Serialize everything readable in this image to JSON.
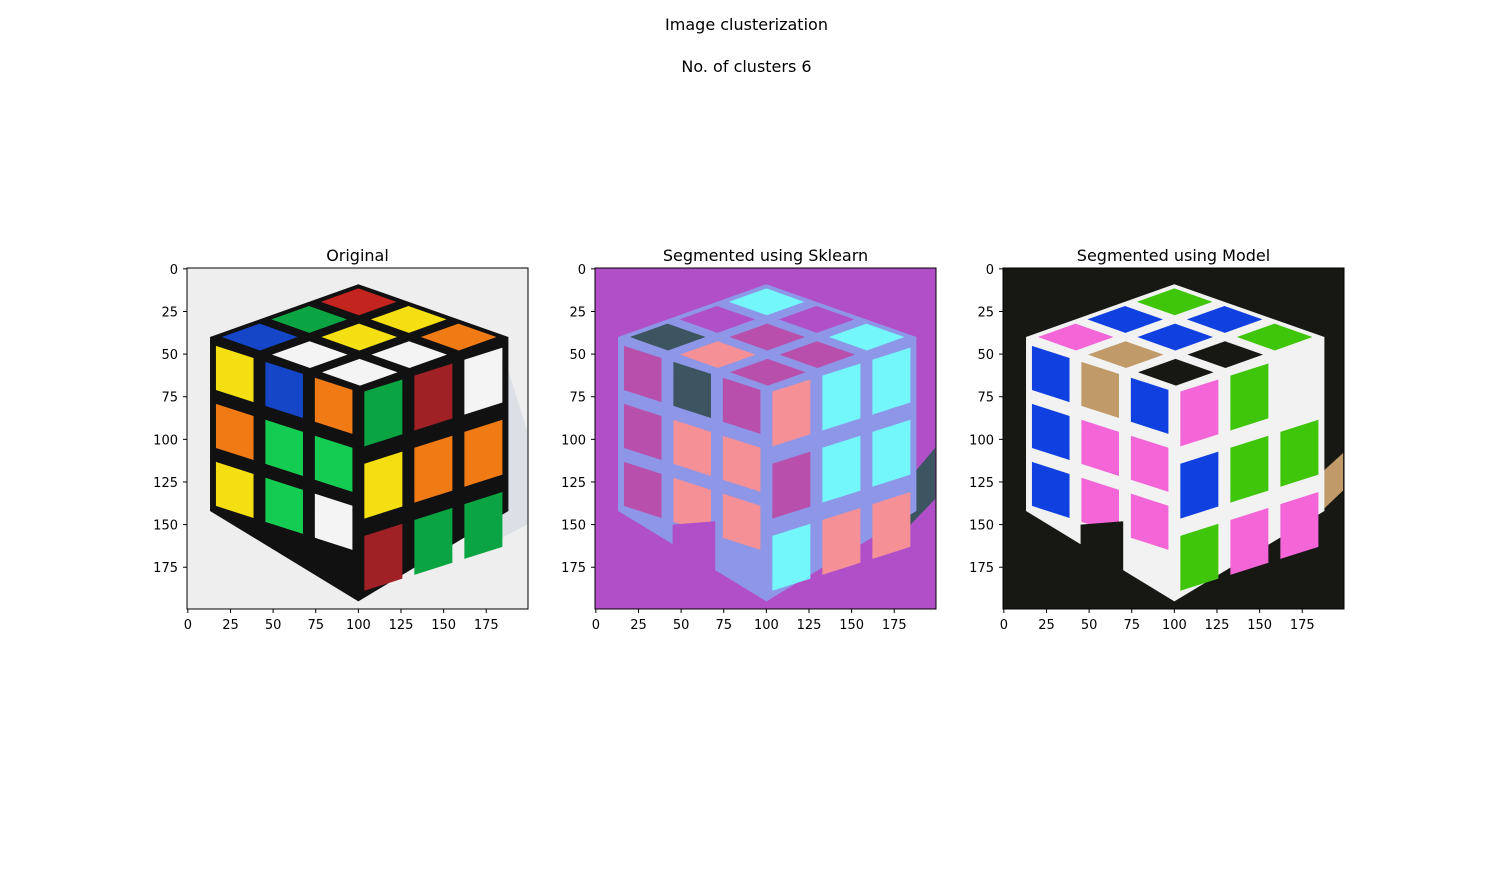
{
  "figure": {
    "title": "Image clusterization",
    "subtitle": "No. of clusters 6"
  },
  "chart_data": [
    {
      "type": "image",
      "title": "Original",
      "xlim": [
        0,
        199
      ],
      "ylim": [
        199,
        0
      ],
      "xticks": [
        0,
        25,
        50,
        75,
        100,
        125,
        150,
        175
      ],
      "yticks": [
        0,
        25,
        50,
        75,
        100,
        125,
        150,
        175
      ],
      "background": "#eeeeee",
      "colors": {
        "red": "#c4241f",
        "orange": "#f07a14",
        "yellow": "#f4e012",
        "green": "#0aa443",
        "green_bright": "#14cc52",
        "blue": "#1546c8",
        "white": "#f4f4f4",
        "maroon": "#a02125",
        "black": "#111111"
      }
    },
    {
      "type": "image",
      "title": "Segmented using Sklearn",
      "xlim": [
        0,
        199
      ],
      "ylim": [
        199,
        0
      ],
      "xticks": [
        0,
        25,
        50,
        75,
        100,
        125,
        150,
        175
      ],
      "yticks": [
        0,
        25,
        50,
        75,
        100,
        125,
        150,
        175
      ],
      "cluster_colors": [
        "#b04fc8",
        "#8e96e8",
        "#f49096",
        "#73f7fb",
        "#3d5461",
        "#b84fac"
      ]
    },
    {
      "type": "image",
      "title": "Segmented using Model",
      "xlim": [
        0,
        199
      ],
      "ylim": [
        199,
        0
      ],
      "xticks": [
        0,
        25,
        50,
        75,
        100,
        125,
        150,
        175
      ],
      "yticks": [
        0,
        25,
        50,
        75,
        100,
        125,
        150,
        175
      ],
      "cluster_colors": [
        "#171814",
        "#f2f2f2",
        "#1040e0",
        "#f465d8",
        "#3fc60b",
        "#c09a68"
      ]
    }
  ]
}
